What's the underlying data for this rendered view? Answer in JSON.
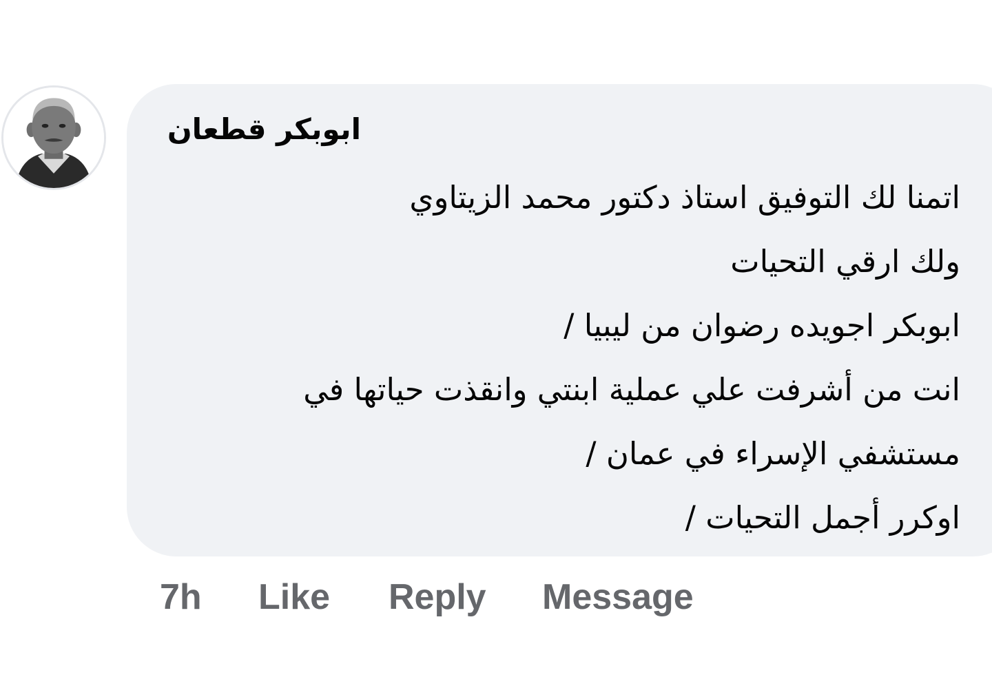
{
  "comment": {
    "author": "ابوبكر قطعان",
    "lines": [
      "اتمنا لك التوفيق استاذ دكتور محمد الزيتاوي",
      "ولك ارقي التحيات",
      "ابوبكر اجويده رضوان من ليبيا /",
      "انت من أشرفت علي عملية ابنتي وانقذت حياتها في",
      "مستشفي الإسراء في عمان /",
      "اوكرر أجمل التحيات /"
    ]
  },
  "actions": {
    "time": "7h",
    "like": "Like",
    "reply": "Reply",
    "message": "Message"
  },
  "colors": {
    "bubble_background": "#f0f2f5",
    "text": "#050505",
    "action_text": "#65676b"
  },
  "icons": {
    "avatar": "profile-photo-avatar"
  }
}
